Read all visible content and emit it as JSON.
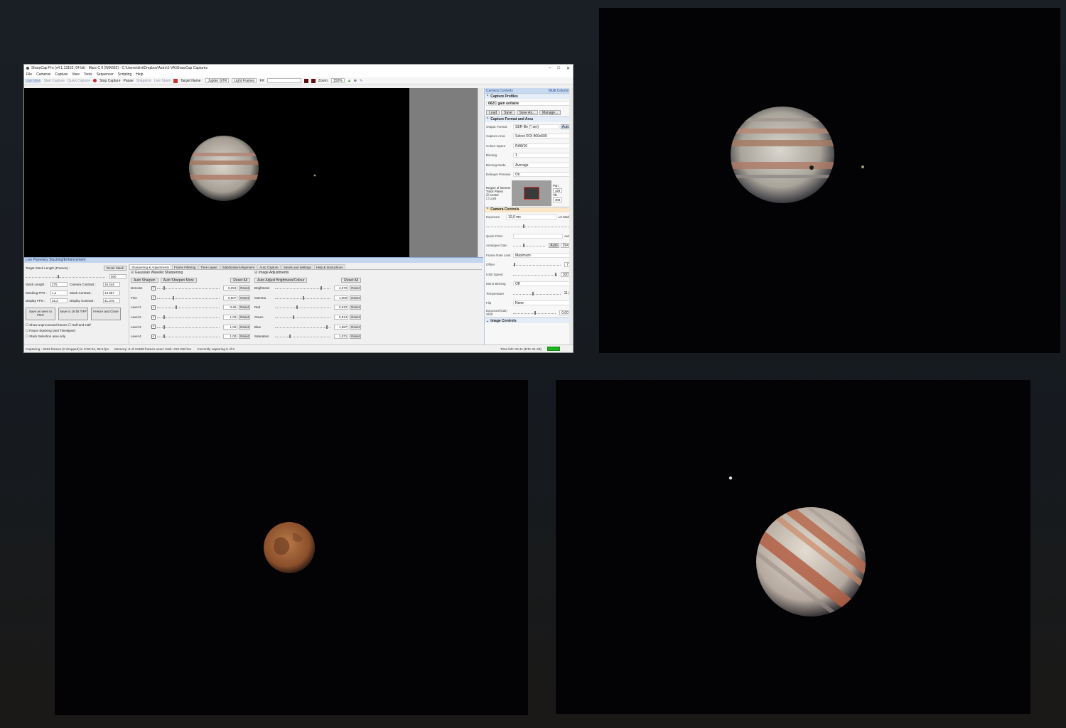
{
  "window": {
    "title": "SharpCap Pro (v4.1.13152, 64 bit) - Mars-C II (IMX662) - C:\\Users\\olivi\\Dropbox\\Astro\\1-VA\\SharpCap Captures",
    "menu": [
      "File",
      "Cameras",
      "Capture",
      "View",
      "Tools",
      "Sequencer",
      "Scripting",
      "Help"
    ]
  },
  "toolbar": {
    "live_view": "Live View",
    "start_capture": "Start Capture",
    "quick_capture": "Quick Capture",
    "stop_capture": "Stop Capture",
    "pause": "Pause",
    "snapshot": "Snapshot",
    "live_stack": "Live Stack",
    "target_name_label": "Target Name :",
    "target_name_value": "Jupiter GTR",
    "frame_type": "Light Frames",
    "fx": "FX",
    "zoom_label": "Zoom:",
    "zoom_value": "150%"
  },
  "camera_controls": {
    "header": "Camera Controls",
    "multi_column": "Multi Column",
    "capture_profiles": "Capture Profiles",
    "profile_value": "662C gain unitaire",
    "profile_buttons": [
      "Load",
      "Save",
      "Save As...",
      "Manage..."
    ],
    "capture_format_section": "Capture Format and Area",
    "format_rows": [
      {
        "label": "Output Format",
        "value": "SER file (*.ser)"
      },
      {
        "label": "Capture Area",
        "value": "Select ROI 800x600"
      },
      {
        "label": "Colour Space",
        "value": "RAW16"
      },
      {
        "label": "Binning",
        "value": "1"
      },
      {
        "label": "Binning Mode",
        "value": "Average"
      },
      {
        "label": "Debayer Preview",
        "value": "On"
      }
    ],
    "auto_label": "Auto",
    "roi": {
      "label": "Region of Interest",
      "track_planet": "Track Planet",
      "center": "Center",
      "lock": "Lock",
      "pan_label": "Pan",
      "pan_value": "428",
      "tilt_label": "Tilt",
      "tilt_value": "308"
    },
    "camera_controls_section": "Camera Controls",
    "exposure_label": "Exposure",
    "exposure_value": "10,0 ms",
    "lx_mode": "LX Mode",
    "quick_picks": "Quick Picks",
    "analogue_gain_label": "Analogue Gain",
    "analogue_gain_value": "294",
    "controls": [
      {
        "label": "Frame Rate Limit",
        "value": "Maximum"
      },
      {
        "label": "Offset",
        "value": "7"
      },
      {
        "label": "USB Speed",
        "value": "100"
      },
      {
        "label": "Mono Binning",
        "value": "Off"
      },
      {
        "label": "Temperature",
        "value": "11,9"
      },
      {
        "label": "Flip",
        "value": "None"
      },
      {
        "label": "Exposure/Gain Shift",
        "value": "0,00"
      }
    ],
    "image_controls_section": "Image Controls"
  },
  "stacking": {
    "header": "Live Planetary Stacking/Enhancement",
    "target_stack_length_label": "Target Stack Length (Frames) :",
    "reset_stack": "Reset Stack",
    "target_stack_value": "600",
    "stats": [
      {
        "label": "Stack Length :",
        "value": "275",
        "label2": "Camera Contrast :",
        "value2": "16.444"
      },
      {
        "label": "Stacking FPS :",
        "value": "1,4",
        "label2": "Stack Contrast :",
        "value2": "13.957"
      },
      {
        "label": "Display FPS :",
        "value": "16,2",
        "label2": "Display Contrast :",
        "value2": "41.375"
      }
    ],
    "action_buttons": [
      "Save as seen to PNG",
      "Save to 16 bit TIFF",
      "Freeze and Close"
    ],
    "options": [
      "Show unprocessed frames",
      "Half-and-Half",
      "Pause Stacking (and Timelapse)",
      "Stack Selection area only"
    ],
    "tabs": [
      "Sharpening & Adjustments",
      "Frame Filtering",
      "Time Lapse",
      "Stabilization/Alignment",
      "Auto Capture",
      "Save/Load Settings",
      "Help & Instructions"
    ],
    "wavelet_label": "Gaussian Wavelet Sharpening",
    "auto_sharpen": "Auto Sharpen",
    "auto_sharpen_more": "Auto Sharpen More",
    "reset_all": "Reset All",
    "reset": "Reset",
    "wavelet_rows": [
      {
        "name": "Denoise",
        "value": "0,094",
        "pos": 0.1
      },
      {
        "name": "Fine",
        "value": "0,807",
        "pos": 0.25
      },
      {
        "name": "Level 1",
        "value": "3,45",
        "pos": 0.3
      },
      {
        "name": "Level 2",
        "value": "1,00",
        "pos": 0.1
      },
      {
        "name": "Level 3",
        "value": "1,00",
        "pos": 0.1
      },
      {
        "name": "Level 4",
        "value": "1,00",
        "pos": 0.1
      }
    ],
    "image_adjustments_label": "Image Adjustments",
    "auto_adjust": "Auto Adjust Brightness/Colour",
    "adjust_rows": [
      {
        "name": "Brightness",
        "value": "2,570",
        "pos": 0.82
      },
      {
        "name": "Gamma",
        "value": "1,000",
        "pos": 0.5
      },
      {
        "name": "Red",
        "value": "0,912",
        "pos": 0.38
      },
      {
        "name": "Green",
        "value": "0,814",
        "pos": 0.32
      },
      {
        "name": "Blue",
        "value": "1,897",
        "pos": 0.92
      },
      {
        "name": "Saturation",
        "value": "1,571",
        "pos": 0.25
      }
    ]
  },
  "status": {
    "capturing": "Capturing : 3453 frames (0 dropped) in 0:00:34, 99.5 fps",
    "memory": "Memory: 8 of 10388 frames used. Disk: 319 GB free",
    "currently": "Currently capturing 5 of 6",
    "time_left": "Time left: 00:41 (ETA 21:48)",
    "progress": 1.0
  },
  "colors": {
    "background": "#181c22",
    "jupiter_band": "#b9826a",
    "mars": "#a05e35",
    "accent_blue": "#c9daf0",
    "progress_green": "#1db41d"
  }
}
